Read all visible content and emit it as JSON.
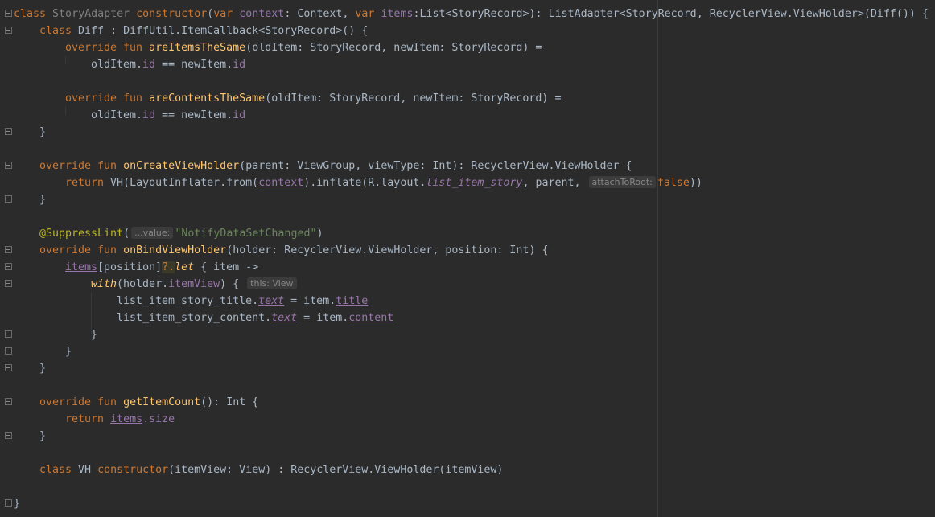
{
  "editor": {
    "language": "kotlin",
    "lines": {
      "l1_kw_class": "class",
      "l1_name": "StoryAdapter",
      "l1_constructor": "constructor",
      "l1_p1": "(",
      "l1_var1": "var",
      "l1_context": "context",
      "l1_p2": ": Context, ",
      "l1_var2": "var",
      "l1_items": "items",
      "l1_p3": ":List<StoryRecord>): ListAdapter<StoryRecord, RecyclerView.ViewHolder>(Diff()) {",
      "l2_kw_class": "class",
      "l2_rest": " Diff : DiffUtil.ItemCallback<StoryRecord>() {",
      "l3_override": "override fun",
      "l3_fn": "areItemsTheSame",
      "l3_rest": "(oldItem: StoryRecord, newItem: StoryRecord) =",
      "l4_a": "oldItem.",
      "l4_id1": "id",
      "l4_b": " == newItem.",
      "l4_id2": "id",
      "l6_override": "override fun",
      "l6_fn": "areContentsTheSame",
      "l6_rest": "(oldItem: StoryRecord, newItem: StoryRecord) =",
      "l7_a": "oldItem.",
      "l7_id1": "id",
      "l7_b": " == newItem.",
      "l7_id2": "id",
      "l8_brace": "}",
      "l10_override": "override fun",
      "l10_fn": "onCreateViewHolder",
      "l10_rest": "(parent: ViewGroup, viewType: Int): RecyclerView.ViewHolder {",
      "l11_return": "return",
      "l11_a": " VH(LayoutInflater.from(",
      "l11_context": "context",
      "l11_b": ").inflate(R.layout.",
      "l11_layout": "list_item_story",
      "l11_c": ", parent, ",
      "l11_hint": "attachToRoot:",
      "l11_false": "false",
      "l11_d": "))",
      "l12_brace": "}",
      "l14_ann": "@SuppressLint",
      "l14_p1": "(",
      "l14_hint": "...value:",
      "l14_str": "\"NotifyDataSetChanged\"",
      "l14_p2": ")",
      "l15_override": "override fun",
      "l15_fn": "onBindViewHolder",
      "l15_rest": "(holder: RecyclerView.ViewHolder, position: Int) {",
      "l16_items": "items",
      "l16_a": "[position]",
      "l16_q": "?.",
      "l16_let": "let",
      "l16_b": " { item ->",
      "l17_with": "with",
      "l17_a": "(holder.",
      "l17_itemview": "itemView",
      "l17_b": ") { ",
      "l17_hint": "this: View",
      "l18_a": "list_item_story_title.",
      "l18_text": "text",
      "l18_b": " = item.",
      "l18_title": "title",
      "l19_a": "list_item_story_content.",
      "l19_text": "text",
      "l19_b": " = item.",
      "l19_content": "content",
      "l20_brace": "}",
      "l21_brace": "}",
      "l22_brace": "}",
      "l24_override": "override fun",
      "l24_fn": "getItemCount",
      "l24_rest": "(): Int {",
      "l25_return": "return",
      "l25_items": "items",
      "l25_size": ".size",
      "l26_brace": "}",
      "l28_kw_class": "class",
      "l28_vh": " VH ",
      "l28_constructor": "constructor",
      "l28_rest": "(itemView: View) : RecyclerView.ViewHolder(itemView)",
      "l30_brace": "}"
    }
  },
  "colors": {
    "background": "#2b2b2b",
    "keyword": "#cc7832",
    "function": "#ffc66d",
    "property": "#9876aa",
    "string": "#6a8759",
    "annotation": "#bbb529",
    "text": "#a9b7c6"
  }
}
